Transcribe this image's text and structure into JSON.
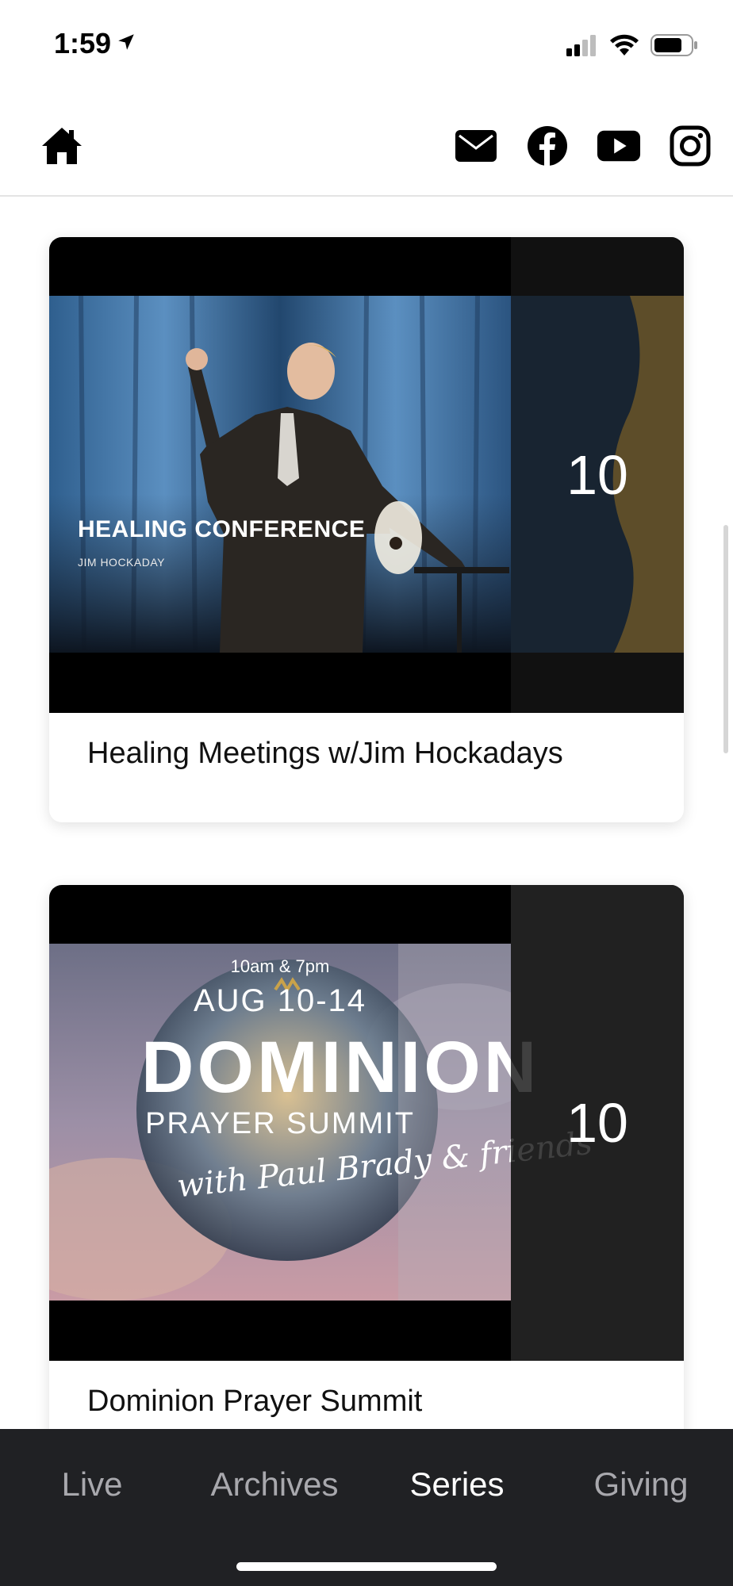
{
  "status_bar": {
    "time": "1:59",
    "icons": [
      "location-arrow-icon",
      "cellular-signal-icon",
      "wifi-icon",
      "battery-icon"
    ]
  },
  "header": {
    "icons": [
      "home-icon",
      "mail-icon",
      "facebook-icon",
      "youtube-icon",
      "instagram-icon"
    ]
  },
  "series": [
    {
      "title": "Healing Meetings w/Jim Hockadays",
      "count": "10",
      "thumb_title": "HEALING CONFERENCE",
      "thumb_subtitle": "JIM HOCKADAY"
    },
    {
      "title": "Dominion Prayer Summit",
      "count": "10",
      "thumb_time": "10am & 7pm",
      "thumb_date": "AUG 10-14",
      "thumb_main": "DOMINION",
      "thumb_sub": "PRAYER SUMMIT",
      "thumb_script": "with Paul Brady & friends"
    }
  ],
  "tabs": [
    {
      "label": "Live",
      "active": false
    },
    {
      "label": "Archives",
      "active": false
    },
    {
      "label": "Series",
      "active": true
    },
    {
      "label": "Giving",
      "active": false
    }
  ],
  "colors": {
    "tab_bar_bg": "#202124",
    "tab_inactive": "#a8a8ad",
    "tab_active": "#ffffff"
  }
}
